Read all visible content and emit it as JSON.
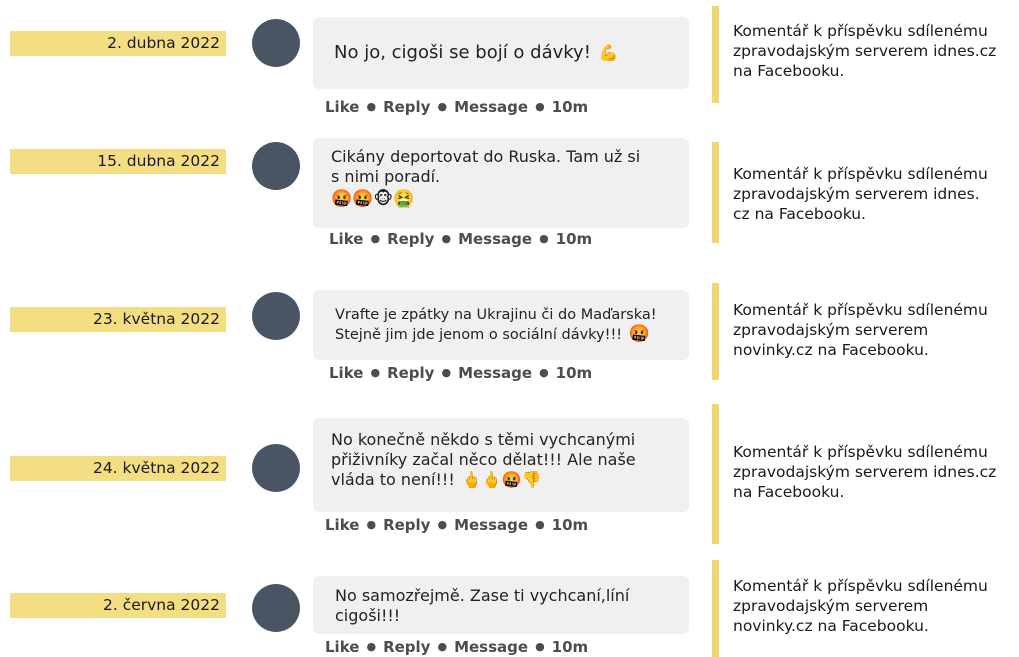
{
  "actions": {
    "like": "Like",
    "reply": "Reply",
    "message": "Message",
    "time": "10m",
    "separator": "●"
  },
  "posts": [
    {
      "date": "2. dubna 2022",
      "text": "No jo, cigoši se bojí o dávky!",
      "emoji": "💪",
      "note_lines": [
        "Komentář k příspěvku sdílenému",
        "zpravodajským serverem idnes.cz",
        "na Facebooku."
      ]
    },
    {
      "date": "15. dubna 2022",
      "text_lines": [
        "Cikány deportovat do Ruska. Tam už si",
        "s nimi poradí."
      ],
      "emoji": "🤬🤬🐵🤮",
      "note_lines": [
        "Komentář k příspěvku sdílenému",
        "zpravodajským serverem idnes.",
        "cz na Facebooku."
      ]
    },
    {
      "date": "23. května 2022",
      "text_lines": [
        "Vrafte je zpátky na Ukrajinu či do Maďarska!",
        "Stejně jim jde jenom o sociální dávky!!!"
      ],
      "emoji": "🤬",
      "note_lines": [
        "Komentář k příspěvku sdílenému",
        "zpravodajským serverem",
        "novinky.cz na Facebooku."
      ]
    },
    {
      "date": "24. května 2022",
      "text_lines": [
        "No konečně někdo s těmi vychcanými",
        "přiživníky začal něco dělat!!! Ale naše",
        "vláda to není!!!"
      ],
      "emoji": "🖕🖕🤬👎",
      "note_lines": [
        "Komentář k příspěvku sdílenému",
        "zpravodajským serverem idnes.cz",
        "na Facebooku."
      ]
    },
    {
      "date": "2. června 2022",
      "text_lines": [
        "No samozřejmě. Zase ti vychcaní,líní",
        "cigoši!!!"
      ],
      "note_lines": [
        "Komentář k příspěvku sdílenému",
        "zpravodajským serverem",
        "novinky.cz na Facebooku."
      ]
    }
  ]
}
